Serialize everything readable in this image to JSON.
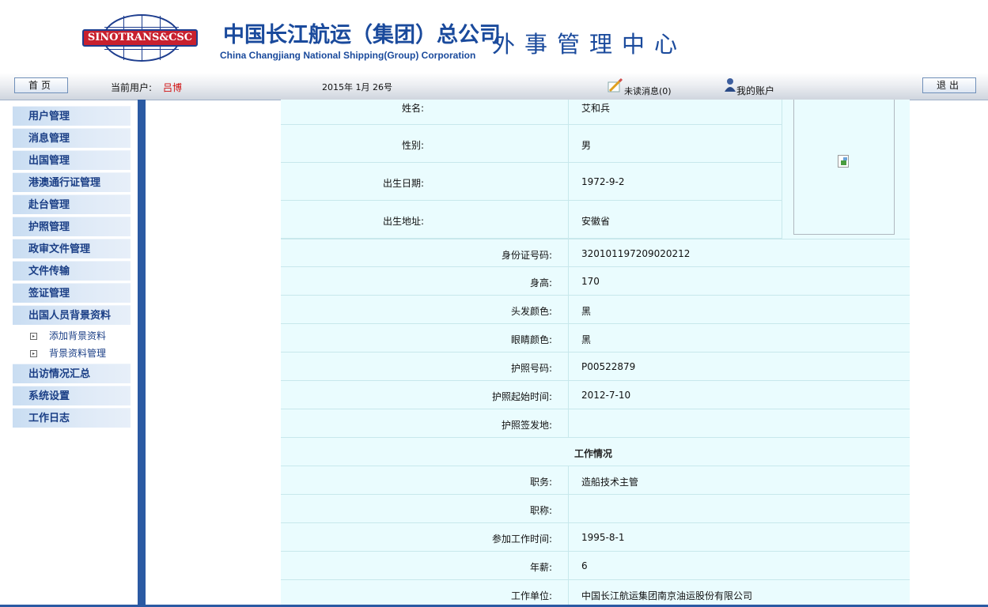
{
  "header": {
    "logo_text": "SINOTRANS&CSC",
    "company_cn": "中国长江航运（集团）总公司",
    "company_en": "China Changjiang National Shipping(Group) Corporation",
    "center_title": "外事管理中心"
  },
  "toolbar": {
    "home_label": "首页",
    "current_user_label": "当前用户:",
    "current_user_name": "吕博",
    "date": "2015年 1月 26号",
    "unread_messages": "未读消息(0)",
    "my_account": "我的账户",
    "logout_label": "退出"
  },
  "sidebar": {
    "items": [
      {
        "label": "用户管理"
      },
      {
        "label": "消息管理"
      },
      {
        "label": "出国管理"
      },
      {
        "label": "港澳通行证管理"
      },
      {
        "label": "赴台管理"
      },
      {
        "label": "护照管理"
      },
      {
        "label": "政审文件管理"
      },
      {
        "label": "文件传输"
      },
      {
        "label": "签证管理"
      },
      {
        "label": "出国人员背景资料"
      }
    ],
    "sub_items": [
      {
        "label": "添加背景资料"
      },
      {
        "label": "背景资料管理"
      }
    ],
    "items_after": [
      {
        "label": "出访情况汇总"
      },
      {
        "label": "系统设置"
      },
      {
        "label": "工作日志"
      }
    ]
  },
  "profile": {
    "name_label": "姓名:",
    "name": "艾和兵",
    "gender_label": "性别:",
    "gender": "男",
    "birth_date_label": "出生日期:",
    "birth_date": "1972-9-2",
    "birth_place_label": "出生地址:",
    "birth_place": "安徽省",
    "id_label": "身份证号码:",
    "id_number": "320101197209020212",
    "height_label": "身高:",
    "height": "170",
    "hair_label": "头发颜色:",
    "hair_color": "黑",
    "eye_label": "眼睛颜色:",
    "eye_color": "黑",
    "passport_label": "护照号码:",
    "passport_number": "P00522879",
    "passport_start_label": "护照起始时间:",
    "passport_start": "2012-7-10",
    "passport_place_label": "护照签发地:",
    "passport_place": ""
  },
  "work": {
    "section_title": "工作情况",
    "position_label": "职务:",
    "position": "造船技术主管",
    "title_label": "职称:",
    "title": "",
    "start_label": "参加工作时间:",
    "start_date": "1995-8-1",
    "salary_label": "年薪:",
    "salary": "6",
    "unit_label": "工作单位:",
    "unit": "中国长江航运集团南京油运股份有限公司"
  },
  "colors": {
    "brand_blue": "#1a4a9c",
    "table_bg": "#eafcfe",
    "sidebar_text": "#1b3f86",
    "user_name": "#d01010"
  }
}
